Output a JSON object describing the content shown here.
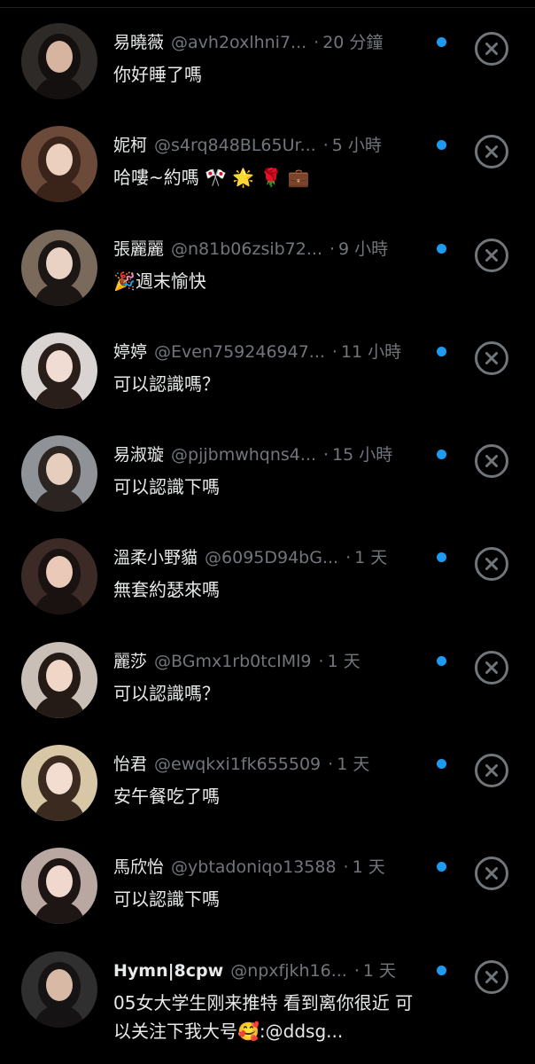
{
  "notifications": [
    {
      "name": "易曉薇",
      "handle": "@avh2oxlhni7...",
      "time": "20 分鐘",
      "message": "你好睡了嗎",
      "avatar_bg": "#2d2a28",
      "avatar_skin": "#d6b4a0",
      "avatar_hair": "#141010"
    },
    {
      "name": "妮柯",
      "handle": "@s4rq848BL65Ur...",
      "time": "5 小時",
      "message": "哈嘍~約嗎 🎌 🌟 🌹 💼",
      "avatar_bg": "#6b4a3a",
      "avatar_skin": "#ecd0bf",
      "avatar_hair": "#3a241a"
    },
    {
      "name": "張麗麗",
      "handle": "@n81b06zsib72...",
      "time": "9 小時",
      "message": "🎉週末愉快",
      "avatar_bg": "#7a6a5c",
      "avatar_skin": "#e9d2c4",
      "avatar_hair": "#1c1714"
    },
    {
      "name": "婷婷",
      "handle": "@Even759246947...",
      "time": "11 小時",
      "message": "可以認識嗎？",
      "avatar_bg": "#d9d4d2",
      "avatar_skin": "#f1dcd3",
      "avatar_hair": "#2a1e1a"
    },
    {
      "name": "易淑璇",
      "handle": "@pjjbmwhqns4...",
      "time": "15 小時",
      "message": "可以認識下嗎",
      "avatar_bg": "#8f9398",
      "avatar_skin": "#e6cdbd",
      "avatar_hair": "#2b2421"
    },
    {
      "name": "溫柔小野貓",
      "handle": "@6095D94bG...",
      "time": "1 天",
      "message": "無套約瑟來嗎",
      "avatar_bg": "#3b2a26",
      "avatar_skin": "#eac9b9",
      "avatar_hair": "#1a1210"
    },
    {
      "name": "麗莎",
      "handle": "@BGmx1rb0tcIMl9",
      "time": "1 天",
      "message": "可以認識嗎？",
      "avatar_bg": "#c9bfb6",
      "avatar_skin": "#efd6c6",
      "avatar_hair": "#241a16"
    },
    {
      "name": "怡君",
      "handle": "@ewqkxi1fk655509",
      "time": "1 天",
      "message": "安午餐吃了嗎",
      "avatar_bg": "#d8c7a6",
      "avatar_skin": "#f2ddd0",
      "avatar_hair": "#3a2a20"
    },
    {
      "name": "馬欣怡",
      "handle": "@ybtadoniqo13588",
      "time": "1 天",
      "message": "可以認識下嗎",
      "avatar_bg": "#b9a8a2",
      "avatar_skin": "#f0d8cf",
      "avatar_hair": "#1e1614"
    },
    {
      "name": "Hymn|8cpw",
      "handle": "@npxfjkh16...",
      "time": "1 天",
      "message": "05女大学生刚来推特 看到离你很近 可以关注下我大号🥰:@ddsg...",
      "avatar_bg": "#2f2f30",
      "avatar_skin": "#d8b9a6",
      "avatar_hair": "#151313",
      "bold_name": true
    }
  ],
  "icons": {
    "unread": "unread-dot-icon",
    "dismiss": "close-circle-icon"
  },
  "colors": {
    "background": "#000000",
    "text": "#e7e9ea",
    "muted": "#71767b",
    "accent": "#1d9bf0"
  }
}
